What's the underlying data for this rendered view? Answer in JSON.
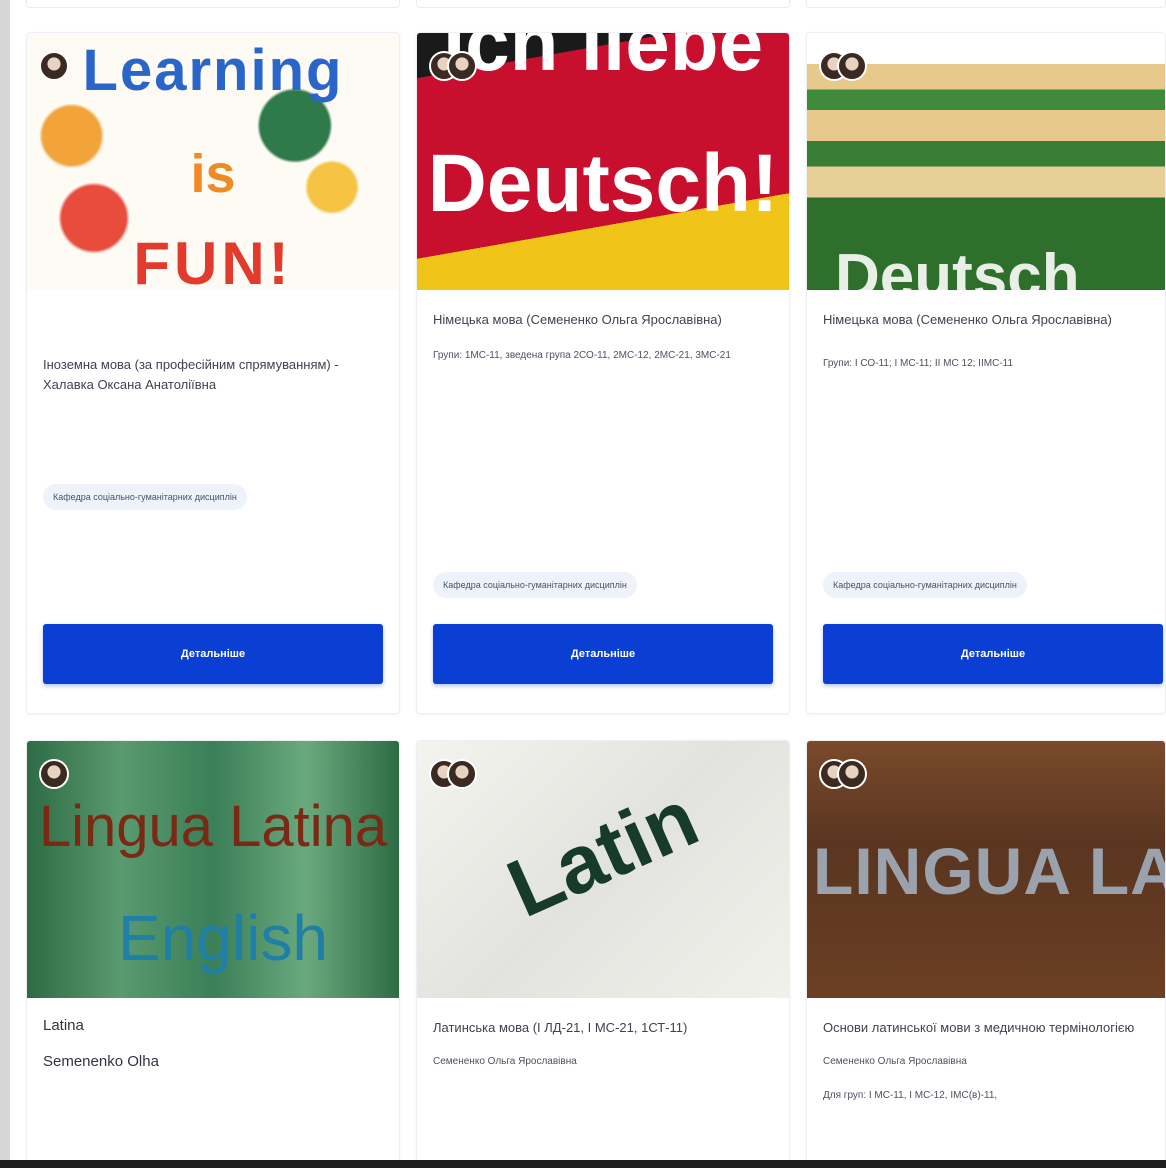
{
  "colors": {
    "button_bg": "#0b3fd4",
    "tag_bg": "#eef3fb",
    "card_border": "#eceff3"
  },
  "courses": [
    {
      "thumbnail_text": [
        "Learning",
        "is",
        "FUN!"
      ],
      "title": "Іноземна мова (за професійним спрямуванням) - Халавка Оксана Анатоліївна",
      "department": "Кафедра соціально-гуманітарних дисциплін",
      "button_label": "Детальніше"
    },
    {
      "thumbnail_text": [
        "Ich liebe",
        "Deutsch!"
      ],
      "title": "Німецька мова (Семененко Ольга Ярославівна)",
      "groups": "Групи: 1МС-11, зведена група 2СО-11, 2МС-12, 2МС-21, 3МС-21",
      "department": "Кафедра соціально-гуманітарних дисциплін",
      "button_label": "Детальніше"
    },
    {
      "thumbnail_text": [
        "Deutsch"
      ],
      "title": "Німецька мова (Семененко Ольга Ярославівна)",
      "groups": "Групи: І СО-11; І МС-11; ІІ МС 12; ІІМС-11",
      "department": "Кафедра соціально-гуманітарних дисциплін",
      "button_label": "Детальніше"
    },
    {
      "thumbnail_text": [
        "Lingua Latina",
        "English"
      ],
      "title": "Latina",
      "subtitle": "Semenenko Olha"
    },
    {
      "thumbnail_text": [
        "Latin"
      ],
      "title": "Латинська мова (І ЛД-21, І МС-21, 1СТ-11)",
      "subtitle": "Семененко Ольга Ярославівна"
    },
    {
      "thumbnail_text": [
        "LINGUA LATINA"
      ],
      "title": "Основи латинської мови з медичною термінологією",
      "subtitle": "Семененко Ольга Ярославівна",
      "groups": "Для груп: І МС-11, І МС-12, ІМС(в)-11,"
    }
  ]
}
